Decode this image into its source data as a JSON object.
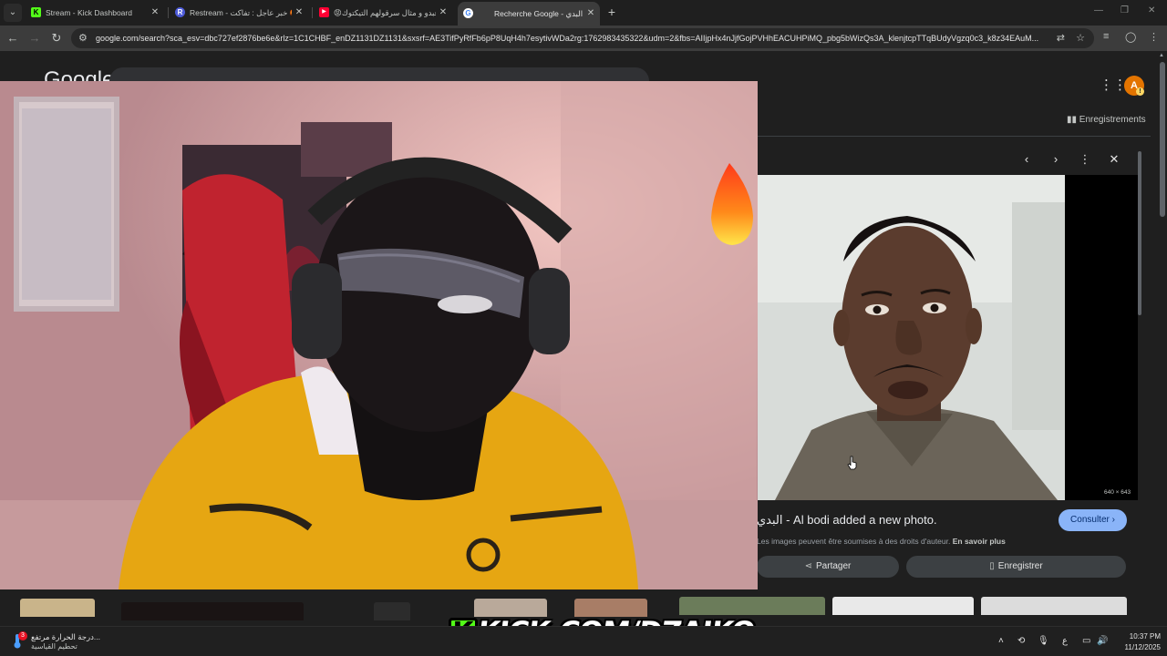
{
  "browser": {
    "tabs": [
      {
        "title": "Stream - Kick Dashboard",
        "favicon": "kick-icon",
        "favicon_color": "#53fc18",
        "active": false
      },
      {
        "title": "Restream - خبر عاجل : تفاكت 🤬",
        "favicon": "restream-icon",
        "favicon_color": "#4d5bd9",
        "active": false
      },
      {
        "title": "😡عبدو و مثال سرقولهم التيكتوك",
        "favicon": "youtube-icon",
        "favicon_color": "#ff0033",
        "active": false
      },
      {
        "title": "Recherche Google - البدي",
        "favicon": "google-icon",
        "favicon_color": "#ffffff",
        "active": true
      }
    ],
    "url": "google.com/search?sca_esv=dbc727ef2876be6e&rlz=1C1CHBF_enDZ1131DZ1131&sxsrf=AE3TifPyRfFb6pP8UqH4h7esytivWDa2rg:1762983435322&udm=2&fbs=AIIjpHx4nJjfGojPVHhEACUHPiMQ_pbg5bWizQs3A_klenjtcpTTqBUdyVgzq0c3_k8z34EAuM..."
  },
  "google": {
    "logo": "Google",
    "saved_link": "Enregistrements",
    "viewer": {
      "title": "البدي - Al bodi added a new photo.",
      "visit_button": "Consulter",
      "rights": "Les images peuvent être soumises à des droits d'auteur.",
      "learn_more": "En savoir plus",
      "share_button": "Partager",
      "save_button": "Enregistrer",
      "image_dims": "640 × 643"
    }
  },
  "watermark": {
    "k": "K",
    "text": "KICK.COM/DZAIKO",
    "brand_color": "#53fc18"
  },
  "taskbar": {
    "weather_title": "درجة الحرارة مرتفع...",
    "weather_sub": "تحطيم القياسية",
    "notification_count": "3",
    "ime": "ع",
    "time": "10:37 PM",
    "date": "11/12/2025"
  }
}
